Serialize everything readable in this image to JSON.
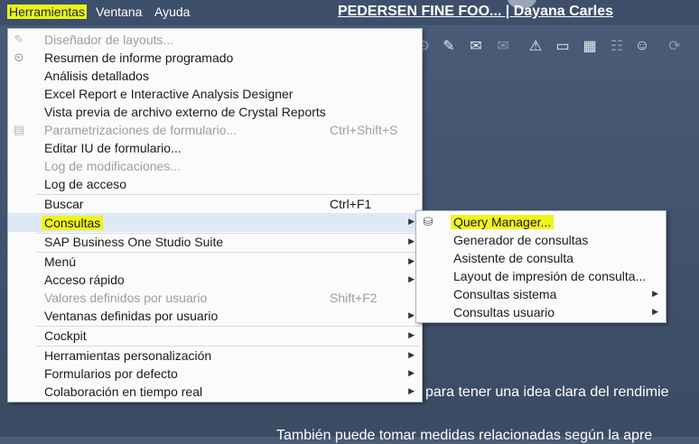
{
  "menubar": {
    "items": [
      {
        "label": "Herramientas"
      },
      {
        "label": "Ventana"
      },
      {
        "label": "Ayuda"
      }
    ],
    "title": "PEDERSEN FINE FOO... | Dayana Carles"
  },
  "toolbar": {
    "icons": [
      "settings-icon",
      "edit-form-icon",
      "message-icon",
      "message-alt-icon",
      "alert-icon",
      "window-icon",
      "calculator-icon",
      "org-chart-icon",
      "user-icon",
      "refresh-icon"
    ]
  },
  "main_menu": {
    "items": [
      {
        "label": "Diseñador de layouts..."
      },
      {
        "label": "Resumen de informe programado"
      },
      {
        "label": "Análisis detallados"
      },
      {
        "label": "Excel Report e Interactive Analysis Designer"
      },
      {
        "label": "Vista previa de archivo externo de Crystal Reports"
      },
      {
        "label": "Parametrizaciones de formulario...",
        "shortcut": "Ctrl+Shift+S"
      },
      {
        "label": "Editar IU de formulario..."
      },
      {
        "label": "Log de modificaciones..."
      },
      {
        "label": "Log de acceso"
      },
      {
        "label": "Buscar",
        "shortcut": "Ctrl+F1"
      },
      {
        "label": "Consultas"
      },
      {
        "label": "SAP Business One Studio Suite"
      },
      {
        "label": "Menú"
      },
      {
        "label": "Acceso rápido"
      },
      {
        "label": "Valores definidos por usuario",
        "shortcut": "Shift+F2"
      },
      {
        "label": "Ventanas definidas por usuario"
      },
      {
        "label": "Cockpit"
      },
      {
        "label": "Herramientas personalización"
      },
      {
        "label": "Formularios por defecto"
      },
      {
        "label": "Colaboración en tiempo real"
      }
    ]
  },
  "sub_menu": {
    "items": [
      {
        "label": "Query Manager..."
      },
      {
        "label": "Generador de consultas"
      },
      {
        "label": "Asistente de consulta"
      },
      {
        "label": "Layout de impresión de consulta..."
      },
      {
        "label": "Consultas sistema"
      },
      {
        "label": "Consultas usuario"
      }
    ]
  },
  "background": {
    "line1": "para tener una idea clara del rendimie",
    "line2": "También puede tomar medidas relacionadas según la apre"
  },
  "colors": {
    "highlight": "#f0f51c",
    "menubar": "#3d4f6b",
    "background": "#45576f"
  }
}
